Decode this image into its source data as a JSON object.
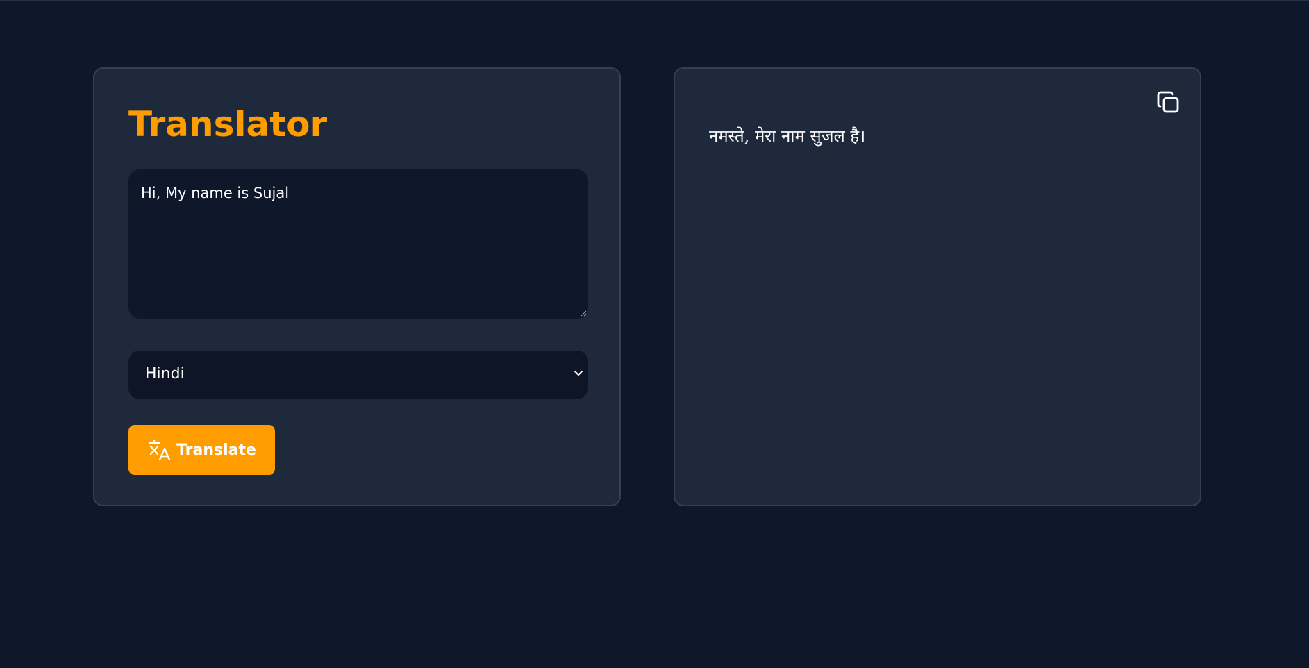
{
  "app": {
    "title": "Translator"
  },
  "input": {
    "value": "Hi, My name is Sujal"
  },
  "language_select": {
    "selected": "Hindi"
  },
  "translate_button": {
    "label": "Translate",
    "icon": "translate-icon"
  },
  "output": {
    "text": "नमस्ते, मेरा नाम सुजल है।",
    "copy_icon": "copy-icon"
  },
  "colors": {
    "background": "#0f172a",
    "panel": "#1e293b",
    "panel_border": "#334155",
    "accent": "#ff9d00",
    "input_bg": "#0f172a",
    "text": "#ffffff"
  }
}
